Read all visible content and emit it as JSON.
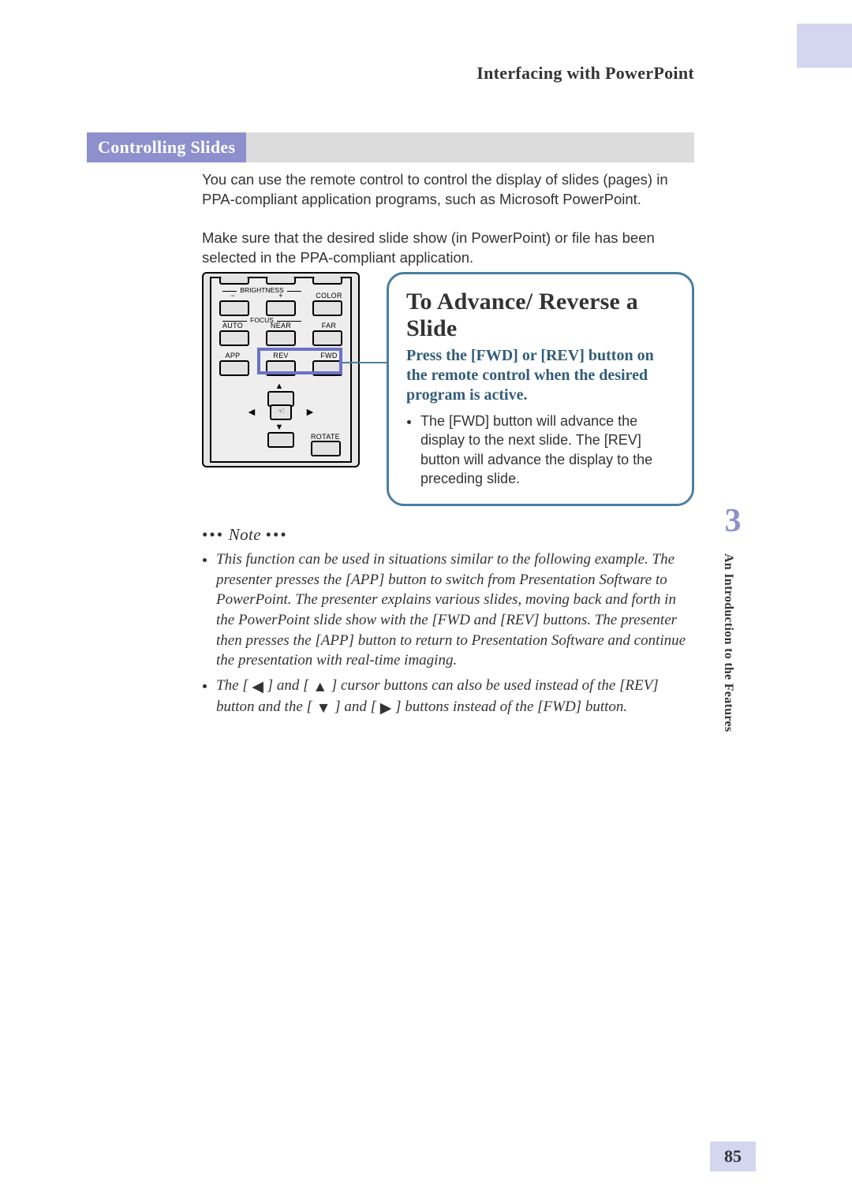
{
  "header": {
    "breadcrumb": "Interfacing with PowerPoint"
  },
  "section": {
    "title": "Controlling Slides"
  },
  "body": {
    "p1": "You can use the remote control to control the display of slides (pages) in PPA-compliant application programs, such as Microsoft PowerPoint.",
    "p2": "Make sure that the desired slide show (in PowerPoint) or file has been selected in the PPA-compliant application."
  },
  "remote": {
    "row0_divider": "BRIGHTNESS",
    "row0_left": "−",
    "row0_right": "+",
    "row0_c3": "COLOR",
    "row1_divider": "FOCUS",
    "row1_c1": "AUTO",
    "row1_c2": "NEAR",
    "row1_c3": "FAR",
    "row2_c1": "APP",
    "row2_c2": "REV",
    "row2_c3": "FWD",
    "rotate": "ROTATE"
  },
  "callout": {
    "title": "To Advance/ Reverse a Slide",
    "lead": "Press the [FWD] or [REV] button on the remote control when the desired program is active.",
    "bullet1": "The [FWD] button will advance the display to the next slide. The [REV] button will advance the display to the preceding slide."
  },
  "note": {
    "heading": "Note",
    "item1": "This function can be used in situations similar to the following example. The presenter presses the [APP] button to switch from Presentation Software to PowerPoint. The presenter explains various slides, moving back and forth in the PowerPoint slide show with the [FWD and [REV] buttons. The presenter then presses the [APP] button to return to Presentation Software and continue the presentation with real-time imaging.",
    "item2_a": "The [ ",
    "item2_b": " ] and [ ",
    "item2_c": " ] cursor buttons can also be used instead of the [REV] button and the [ ",
    "item2_d": " ] and [ ",
    "item2_e": " ] buttons instead of the [FWD] button."
  },
  "side": {
    "chapter_number": "3",
    "chapter_title": "An Introduction to the Features"
  },
  "footer": {
    "page_number": "85"
  }
}
